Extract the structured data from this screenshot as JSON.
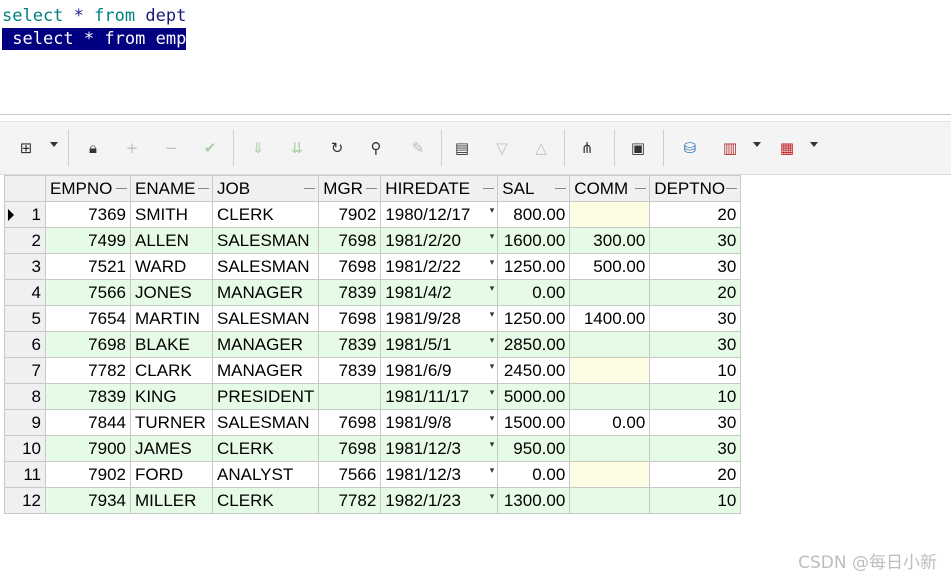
{
  "editor": {
    "line1": {
      "kw1": "select",
      "op": "*",
      "kw2": "from",
      "table": "dept"
    },
    "line2": {
      "kw1": "select",
      "op": "*",
      "kw2": "from",
      "table": "emp"
    }
  },
  "toolbar": {
    "icons": [
      "grid-icon",
      "lock-icon",
      "plus-icon",
      "minus-icon",
      "check-icon",
      "filter-down-icon",
      "filter-clear-icon",
      "refresh-icon",
      "find-icon",
      "clear-icon",
      "sql-icon",
      "sort-desc-icon",
      "sort-asc-icon",
      "query-tree-icon",
      "save-icon",
      "export-icon",
      "chart-icon",
      "table-icon"
    ]
  },
  "grid": {
    "columns": [
      "EMPNO",
      "ENAME",
      "JOB",
      "MGR",
      "HIREDATE",
      "SAL",
      "COMM",
      "DEPTNO"
    ],
    "rows": [
      {
        "no": "1",
        "empno": "7369",
        "ename": "SMITH",
        "job": "CLERK",
        "mgr": "7902",
        "hiredate": "1980/12/17",
        "sal": "800.00",
        "comm": "",
        "deptno": "20"
      },
      {
        "no": "2",
        "empno": "7499",
        "ename": "ALLEN",
        "job": "SALESMAN",
        "mgr": "7698",
        "hiredate": "1981/2/20",
        "sal": "1600.00",
        "comm": "300.00",
        "deptno": "30"
      },
      {
        "no": "3",
        "empno": "7521",
        "ename": "WARD",
        "job": "SALESMAN",
        "mgr": "7698",
        "hiredate": "1981/2/22",
        "sal": "1250.00",
        "comm": "500.00",
        "deptno": "30"
      },
      {
        "no": "4",
        "empno": "7566",
        "ename": "JONES",
        "job": "MANAGER",
        "mgr": "7839",
        "hiredate": "1981/4/2",
        "sal": "0.00",
        "comm": "",
        "deptno": "20"
      },
      {
        "no": "5",
        "empno": "7654",
        "ename": "MARTIN",
        "job": "SALESMAN",
        "mgr": "7698",
        "hiredate": "1981/9/28",
        "sal": "1250.00",
        "comm": "1400.00",
        "deptno": "30"
      },
      {
        "no": "6",
        "empno": "7698",
        "ename": "BLAKE",
        "job": "MANAGER",
        "mgr": "7839",
        "hiredate": "1981/5/1",
        "sal": "2850.00",
        "comm": "",
        "deptno": "30"
      },
      {
        "no": "7",
        "empno": "7782",
        "ename": "CLARK",
        "job": "MANAGER",
        "mgr": "7839",
        "hiredate": "1981/6/9",
        "sal": "2450.00",
        "comm": "",
        "deptno": "10"
      },
      {
        "no": "8",
        "empno": "7839",
        "ename": "KING",
        "job": "PRESIDENT",
        "mgr": "",
        "hiredate": "1981/11/17",
        "sal": "5000.00",
        "comm": "",
        "deptno": "10"
      },
      {
        "no": "9",
        "empno": "7844",
        "ename": "TURNER",
        "job": "SALESMAN",
        "mgr": "7698",
        "hiredate": "1981/9/8",
        "sal": "1500.00",
        "comm": "0.00",
        "deptno": "30"
      },
      {
        "no": "10",
        "empno": "7900",
        "ename": "JAMES",
        "job": "CLERK",
        "mgr": "7698",
        "hiredate": "1981/12/3",
        "sal": "950.00",
        "comm": "",
        "deptno": "30"
      },
      {
        "no": "11",
        "empno": "7902",
        "ename": "FORD",
        "job": "ANALYST",
        "mgr": "7566",
        "hiredate": "1981/12/3",
        "sal": "0.00",
        "comm": "",
        "deptno": "20"
      },
      {
        "no": "12",
        "empno": "7934",
        "ename": "MILLER",
        "job": "CLERK",
        "mgr": "7782",
        "hiredate": "1982/1/23",
        "sal": "1300.00",
        "comm": "",
        "deptno": "10"
      }
    ]
  },
  "watermark": "CSDN @每日小新",
  "colors": {
    "selection": "#000080",
    "keyword": "#008080",
    "row_alt": "#e6fbe6",
    "null_cell": "#fcfde3"
  }
}
